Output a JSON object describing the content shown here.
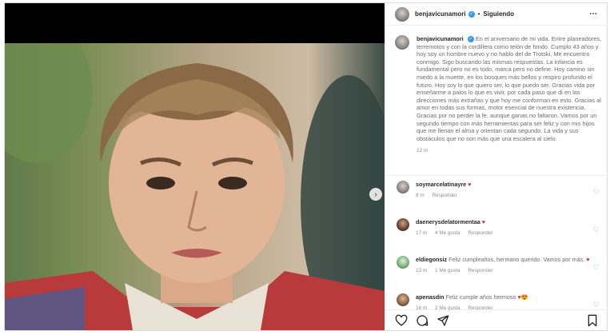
{
  "post": {
    "username": "benjavicunamori",
    "follow_status": "Siguiendo",
    "caption": "En el aniversario de mi vida. Entre planeadores, terremotos y con la cordillera como telón de fondo. Cumplo 43 años y hoy soy un hombre nuevo y no hablo del de Trotski. Me encuentro conmigo. Sigo buscando las mismas respuestas. La infancia es fundamental pero no es todo, marca pero no define. Hoy camino sin miedo a la muerte, en los bosques más bellos y respiro profundo el futuro. Hoy soy lo que quiero ser, lo que puedo ser. Gracias vida por enseñarme a palos lo que es vivir, por cada paso que di en las direcciones más extrañas y que hoy me conforman en esto. Gracias al amor en todas sus formas, motor esencial de nuestra existencia. Gracias por no perder la fe, aunque ganas no faltaron. Vamos por un segundo tiempo con más herramientas para ser feliz y con mis hijos que me llenan el alma y orientan cada segundo. La vida y sus obstáculos que no son más que una escalera al cielo.",
    "caption_time": "12 m"
  },
  "comments": [
    {
      "user": "soymarcelatinayre",
      "text": "",
      "emoji": "♥",
      "time": "8 m",
      "likes": "",
      "reply": "Responder"
    },
    {
      "user": "daenerysdelatormentaa",
      "text": "",
      "emoji": "♥",
      "time": "17 m",
      "likes": "4 Me gusta",
      "reply": "Responder"
    },
    {
      "user": "eldiegonsiz",
      "text": "Feliz cumpleaños, hermano querido. Vamos por más.",
      "emoji": "♥",
      "time": "13 m",
      "likes": "1 Me gusta",
      "reply": "Responder"
    },
    {
      "user": "apenasdin",
      "text": "Feliz cumple años hermoso",
      "emoji": "♥😍",
      "time": "16 m",
      "likes": "2 Me gusta",
      "reply": "Responder"
    }
  ],
  "icons": {
    "more": "⋯",
    "next": "›",
    "heart": "♡",
    "verified": "✓"
  },
  "colors": {
    "verified": "#3897f0",
    "like_red": "#d62d3f"
  }
}
